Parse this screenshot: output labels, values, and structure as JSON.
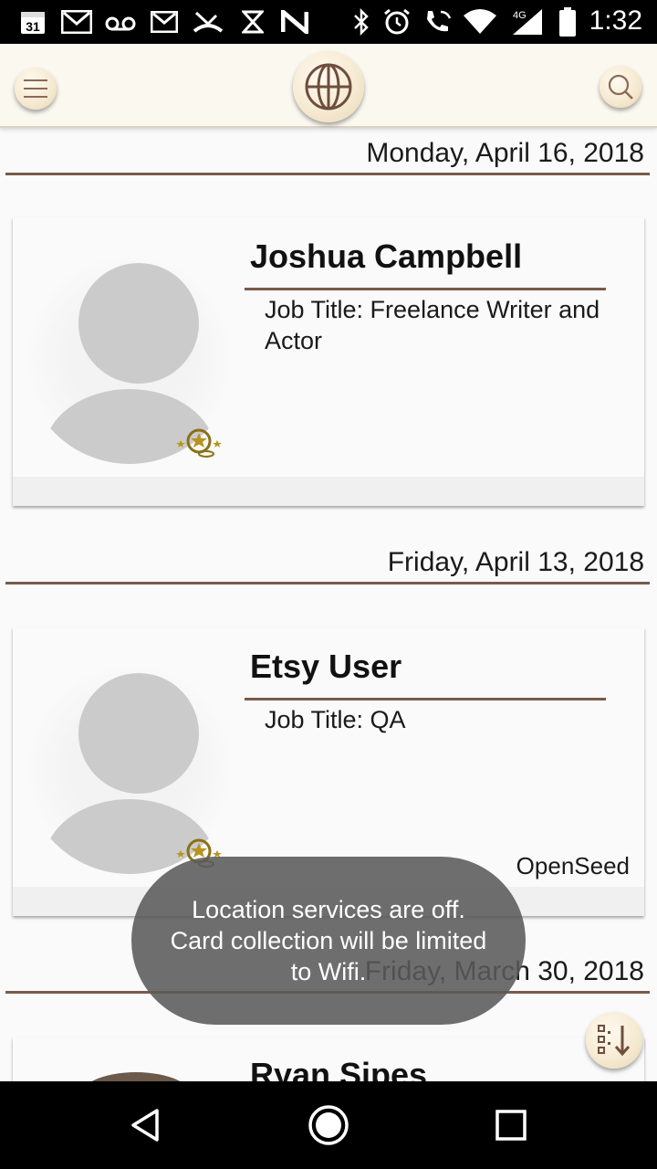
{
  "status_bar": {
    "time": "1:32",
    "network": "4G",
    "calendar_day": "31",
    "icons": [
      "calendar-icon",
      "gmail-icon",
      "voicemail-icon",
      "gmail-icon",
      "missed-call-icon",
      "hourglass-icon",
      "n-icon",
      "bluetooth-icon",
      "alarm-icon",
      "wifi-calling-icon",
      "wifi-icon",
      "signal-icon",
      "battery-icon"
    ]
  },
  "header": {
    "menu_icon": "hamburger-icon",
    "logo_icon": "globe-icon",
    "search_icon": "search-icon"
  },
  "feed": [
    {
      "date": "Monday, April 16, 2018",
      "name": "Joshua Campbell",
      "job": "Job Title: Freelance Writer and Actor",
      "org": ""
    },
    {
      "date": "Friday, April 13, 2018",
      "name": "Etsy User",
      "job": "Job Title: QA",
      "org": "OpenSeed"
    },
    {
      "date": "Friday, March 30, 2018",
      "name": "Ryan Sipes",
      "job": "",
      "org": ""
    }
  ],
  "toast": "Location services are off. Card collection will be limited to Wifi.",
  "colors": {
    "accent_rule": "#7a5a4a",
    "header_bg": "#fbf8f0",
    "button_fill": "#f6ead2"
  }
}
